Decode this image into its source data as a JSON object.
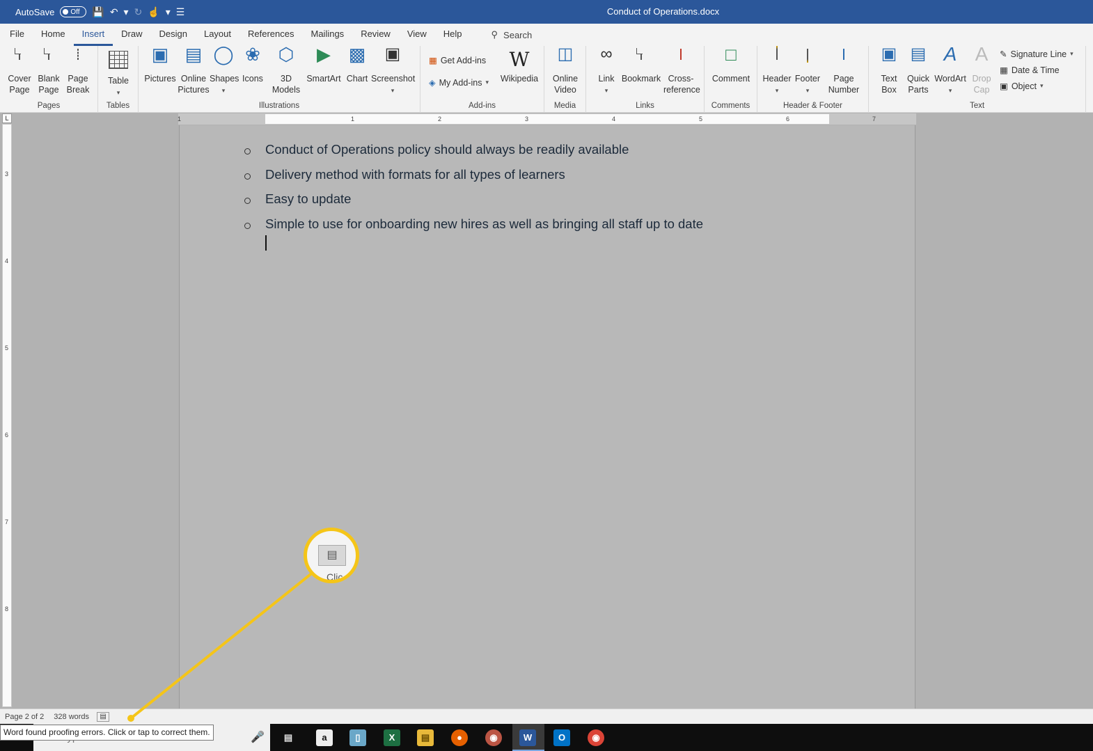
{
  "titlebar": {
    "autosave_label": "AutoSave",
    "autosave_state": "Off",
    "doc_title": "Conduct of Operations.docx"
  },
  "tabs": [
    "File",
    "Home",
    "Insert",
    "Draw",
    "Design",
    "Layout",
    "References",
    "Mailings",
    "Review",
    "View",
    "Help"
  ],
  "search_label": "Search",
  "ribbon": {
    "pages": {
      "group": "Pages",
      "cover_page": "Cover Page",
      "blank_page": "Blank Page",
      "page_break": "Page Break"
    },
    "tables": {
      "group": "Tables",
      "table": "Table"
    },
    "illustrations": {
      "group": "Illustrations",
      "pictures": "Pictures",
      "online_pictures": "Online Pictures",
      "shapes": "Shapes",
      "icons": "Icons",
      "models_3d": "3D Models",
      "smartart": "SmartArt",
      "chart": "Chart",
      "screenshot": "Screenshot"
    },
    "addins": {
      "group": "Add-ins",
      "get_addins": "Get Add-ins",
      "my_addins": "My Add-ins",
      "wikipedia": "Wikipedia",
      "wiki_glyph": "W"
    },
    "media": {
      "group": "Media",
      "online_video": "Online Video"
    },
    "links": {
      "group": "Links",
      "link": "Link",
      "bookmark": "Bookmark",
      "cross_reference": "Cross-reference"
    },
    "comments": {
      "group": "Comments",
      "comment": "Comment"
    },
    "header_footer": {
      "group": "Header & Footer",
      "header": "Header",
      "footer": "Footer",
      "page_number": "Page Number"
    },
    "text": {
      "group": "Text",
      "text_box": "Text Box",
      "quick_parts": "Quick Parts",
      "wordart": "WordArt",
      "drop_cap": "Drop Cap",
      "signature_line": "Signature Line",
      "date_time": "Date & Time",
      "object": "Object"
    }
  },
  "ruler": {
    "h_numbers": [
      "1",
      "1",
      "2",
      "3",
      "4",
      "5",
      "6",
      "7"
    ],
    "v_numbers": [
      "3",
      "4",
      "5",
      "6",
      "7",
      "8"
    ],
    "corner": "L"
  },
  "document": {
    "bullets": [
      "Conduct of Operations policy should always be readily available",
      "Delivery method with formats for all types of learners",
      "Easy to update",
      "Simple to use for onboarding new hires as well as bringing all staff up to date"
    ]
  },
  "status": {
    "page": "Page 2 of 2",
    "words": "328 words",
    "tooltip": "Word found proofing errors. Click or tap to correct them."
  },
  "taskbar": {
    "search_placeholder": "Type here to search"
  },
  "callout": {
    "color": "#f5c518",
    "magnified_text": "Clic"
  },
  "colors": {
    "titlebar": "#2b579a",
    "canvas": "#b2b2b2"
  }
}
